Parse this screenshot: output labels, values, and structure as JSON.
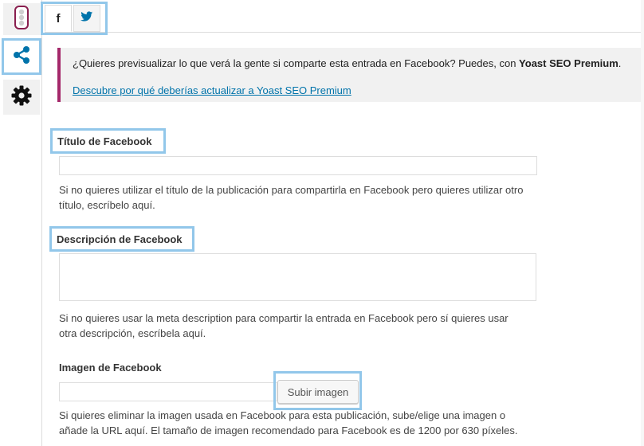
{
  "sidebar": {
    "tabs": [
      {
        "name": "readability",
        "icon": "traffic-light-icon"
      },
      {
        "name": "social",
        "icon": "share-icon",
        "active": true
      },
      {
        "name": "advanced",
        "icon": "gear-icon"
      }
    ]
  },
  "networks": {
    "facebook_glyph": "f",
    "twitter_icon": "twitter-bird-icon"
  },
  "notice": {
    "text_before": "¿Quieres previsualizar lo que verá la gente si comparte esta entrada en Facebook? Puedes, con ",
    "text_bold": "Yoast SEO Premium",
    "text_after": ".",
    "link": "Descubre por qué deberías actualizar a Yoast SEO Premium"
  },
  "fields": {
    "title": {
      "label": "Título de Facebook",
      "value": "",
      "help_line1": "Si no quieres utilizar el título de la publicación para compartirla en Facebook pero quieres utilizar otro",
      "help_line2": "título, escríbelo aquí."
    },
    "description": {
      "label": "Descripción de Facebook",
      "value": "",
      "help_line1": "Si no quieres usar la meta description para compartir la entrada en Facebook pero sí quieres usar",
      "help_line2": "otra descripción, escríbela aquí."
    },
    "image": {
      "label": "Imagen de Facebook",
      "value": "",
      "button": "Subir imagen",
      "help_line1": "Si quieres eliminar la imagen usada en Facebook para esta publicación, sube/elige una imagen o",
      "help_line2": "añade la URL aquí. El tamaño de imagen recomendado para Facebook es de 1200 por 630 píxeles."
    }
  },
  "colors": {
    "accent_blue": "#0073aa",
    "highlight": "#92c7ea",
    "notice_border": "#a4286a"
  }
}
